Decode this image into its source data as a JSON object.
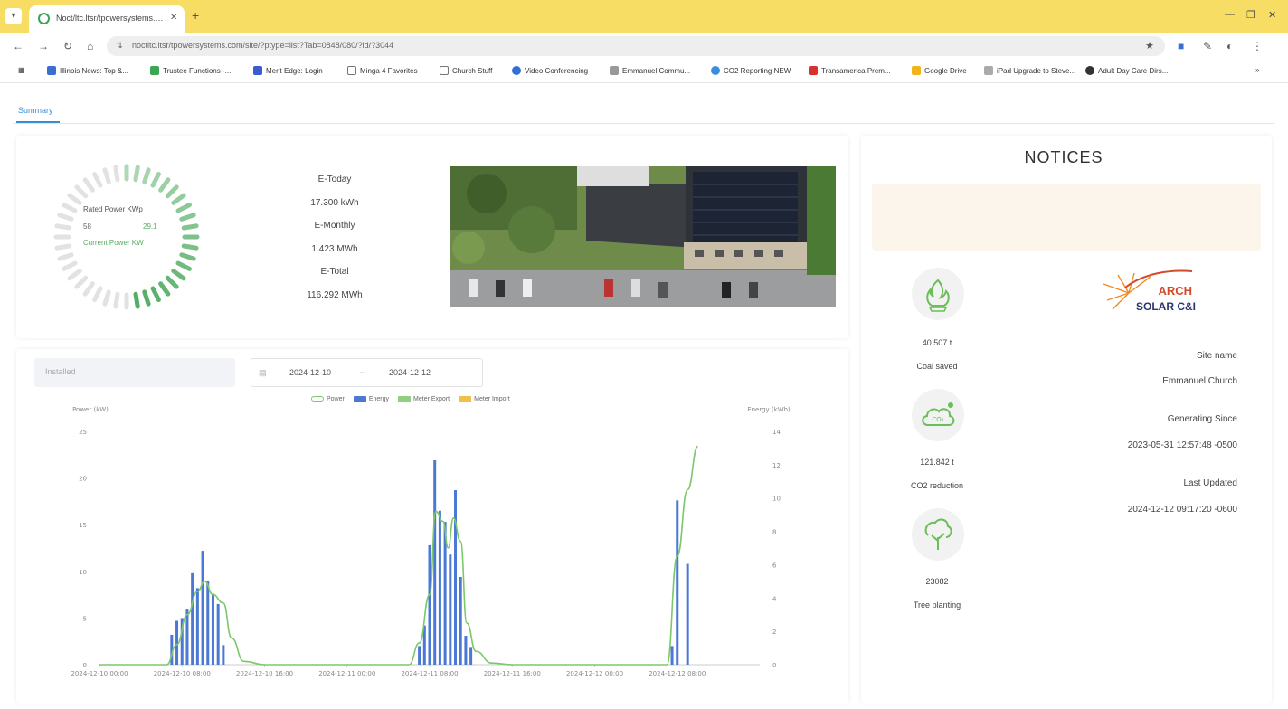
{
  "browser": {
    "tab_title": "Noct/ltc.ltsr/tpowersystems.c...",
    "url": "noctltc.ltsr/tpowersystems.com/site/?ptype=list?Tab=0848/080/?id/?3044",
    "bookmarks": [
      {
        "label": "Illinois News: Top &...",
        "color": "#3a6fd0"
      },
      {
        "label": "Trustee Functions -...",
        "color": "#3aa655"
      },
      {
        "label": "Merit Edge: Login",
        "color": "#3d5bd0"
      },
      {
        "label": "Minga 4 Favorites",
        "color": "#888888"
      },
      {
        "label": "Church Stuff",
        "color": "#888888"
      },
      {
        "label": "Video Conferencing",
        "color": "#2f6fd6"
      },
      {
        "label": "Emmanuel Commu...",
        "color": "#666666"
      },
      {
        "label": "CO2 Reporting NEW",
        "color": "#3b8ddb"
      },
      {
        "label": "Transamerica Prem...",
        "color": "#d63030"
      },
      {
        "label": "Google Drive",
        "color": "#f2b31b"
      },
      {
        "label": "iPad Upgrade to Steve...",
        "color": "#666666"
      },
      {
        "label": "Adult Day Care Dirs...",
        "color": "#333333"
      }
    ]
  },
  "page": {
    "tab_label": "Summary"
  },
  "gauge": {
    "rated_label": "Rated Power KWp",
    "left_val": "58",
    "right_val": "29.1",
    "current_label": "Current Power KW",
    "fraction": 0.5
  },
  "stats": {
    "e_today_label": "E-Today",
    "e_today_val": "17.300 kWh",
    "e_month_label": "E-Monthly",
    "e_month_val": "1.423 MWh",
    "e_total_label": "E-Total",
    "e_total_val": "116.292 MWh"
  },
  "chart_controls": {
    "select_placeholder": "Installed",
    "date_start": "2024-12-10",
    "date_sep": "~",
    "date_end": "2024-12-12"
  },
  "chart_data": {
    "type": "bar",
    "legend": [
      "Power",
      "Energy",
      "Meter Export",
      "Meter Import"
    ],
    "left_axis_label": "Power (kW)",
    "right_axis_label": "Energy (kWh)",
    "left_ylim": [
      0,
      25
    ],
    "left_ticks": [
      "0",
      "5",
      "10",
      "15",
      "20",
      "25"
    ],
    "right_ylim": [
      0,
      14
    ],
    "right_ticks": [
      "0",
      "2",
      "4",
      "6",
      "8",
      "10",
      "12",
      "14"
    ],
    "x_tick_labels": [
      "2024-12-10 00:00",
      "2024-12-10 08:00",
      "2024-12-10 16:00",
      "2024-12-11 00:00",
      "2024-12-11 08:00",
      "2024-12-11 16:00",
      "2024-12-12 00:00",
      "2024-12-12 08:00"
    ],
    "x_range_hours": [
      0,
      64
    ],
    "energy_bars": [
      {
        "h": 7,
        "v": 3.2
      },
      {
        "h": 7.5,
        "v": 4.7
      },
      {
        "h": 8,
        "v": 5.0
      },
      {
        "h": 8.5,
        "v": 6.0
      },
      {
        "h": 9,
        "v": 9.8
      },
      {
        "h": 9.5,
        "v": 8.2
      },
      {
        "h": 10,
        "v": 12.2
      },
      {
        "h": 10.5,
        "v": 9.0
      },
      {
        "h": 11,
        "v": 7.6
      },
      {
        "h": 11.5,
        "v": 6.5
      },
      {
        "h": 12,
        "v": 2.1
      },
      {
        "h": 31,
        "v": 2.0
      },
      {
        "h": 31.5,
        "v": 4.2
      },
      {
        "h": 32,
        "v": 12.8
      },
      {
        "h": 32.5,
        "v": 21.9
      },
      {
        "h": 33,
        "v": 16.5
      },
      {
        "h": 33.5,
        "v": 15.3
      },
      {
        "h": 34,
        "v": 11.8
      },
      {
        "h": 34.5,
        "v": 18.7
      },
      {
        "h": 35,
        "v": 9.4
      },
      {
        "h": 35.5,
        "v": 3.1
      },
      {
        "h": 36,
        "v": 1.9
      },
      {
        "h": 55.5,
        "v": 2.0
      },
      {
        "h": 56,
        "v": 17.6
      },
      {
        "h": 57,
        "v": 10.8
      }
    ],
    "power_line": [
      [
        0,
        0
      ],
      [
        6.5,
        0
      ],
      [
        7.5,
        1.2
      ],
      [
        8.5,
        3.0
      ],
      [
        9.5,
        4.4
      ],
      [
        10.2,
        5.0
      ],
      [
        11,
        4.2
      ],
      [
        12,
        3.7
      ],
      [
        12.8,
        1.6
      ],
      [
        14,
        0.2
      ],
      [
        16,
        0
      ],
      [
        30,
        0
      ],
      [
        31,
        1.3
      ],
      [
        32,
        4.2
      ],
      [
        32.6,
        9.2
      ],
      [
        33.3,
        8.6
      ],
      [
        33.8,
        7.0
      ],
      [
        34.3,
        8.8
      ],
      [
        35,
        7.4
      ],
      [
        35.6,
        2.5
      ],
      [
        36.5,
        0.8
      ],
      [
        38,
        0.1
      ],
      [
        40,
        0
      ],
      [
        55,
        0
      ],
      [
        56,
        6.5
      ],
      [
        57,
        10.5
      ],
      [
        58,
        13.1
      ]
    ]
  },
  "notices": {
    "title": "NOTICES"
  },
  "environment": {
    "coal_val": "40.507 t",
    "coal_label": "Coal saved",
    "co2_val": "121.842 t",
    "co2_label": "CO2 reduction",
    "co2_badge": "CO₂",
    "tree_val": "23082",
    "tree_label": "Tree planting"
  },
  "site_info": {
    "logo_top": "ARCH",
    "logo_bottom": "SOLAR C&I",
    "site_name_label": "Site name",
    "site_name_val": "Emmanuel Church",
    "generating_label": "Generating Since",
    "generating_val": "2023-05-31 12:57:48 -0500",
    "updated_label": "Last Updated",
    "updated_val": "2024-12-12 09:17:20 -0600"
  },
  "colors": {
    "power": "#7cc86a",
    "energy": "#4a78d4",
    "meter_export": "#8fd07e",
    "meter_import": "#f1c04a",
    "gauge_active": "#4fab5f",
    "eco_green": "#6abf58"
  }
}
